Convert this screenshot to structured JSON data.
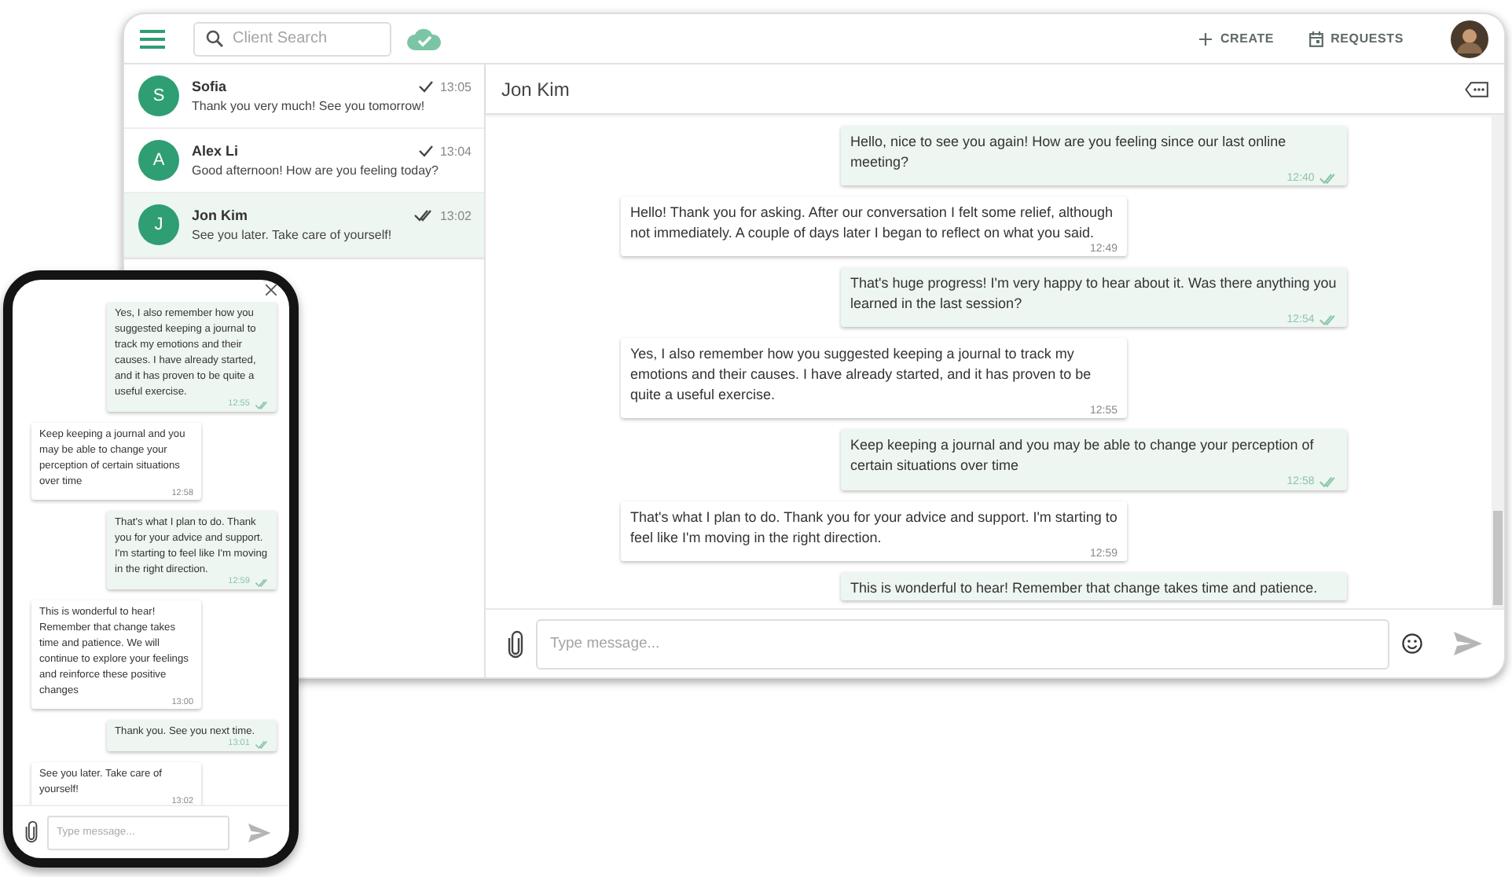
{
  "desktop": {
    "header": {
      "search": {
        "placeholder": "Client Search"
      },
      "actions": [
        {
          "kind": "create",
          "label": "CREATE"
        },
        {
          "kind": "requests",
          "label": "REQUESTS"
        }
      ]
    },
    "conversations": [
      {
        "initial": "S",
        "name": "Sofia",
        "preview": "Thank you very much! See you tomorrow!",
        "time": "13:05",
        "read": false,
        "selected": false
      },
      {
        "initial": "A",
        "name": "Alex Li",
        "preview": "Good afternoon! How are you feeling today?",
        "time": "13:04",
        "read": false,
        "selected": false
      },
      {
        "initial": "J",
        "name": "Jon Kim",
        "preview": "See you later. Take care of yourself!",
        "time": "13:02",
        "read": true,
        "selected": true
      }
    ],
    "chat": {
      "title": "Jon Kim",
      "messages": [
        {
          "outgoing": true,
          "text": "Hello, nice to see you again! How are you feeling since our last online meeting?",
          "time": "12:40",
          "read": true
        },
        {
          "outgoing": false,
          "text": "Hello! Thank you for asking. After our conversation I felt some relief, although not immediately. A couple of days later I began to reflect on what you said.",
          "time": "12:49"
        },
        {
          "outgoing": true,
          "text": "That's huge progress! I'm very happy to hear about it. Was there anything you learned in the last session?",
          "time": "12:54",
          "read": true
        },
        {
          "outgoing": false,
          "text": "Yes, I also remember how you suggested keeping a journal to track my emotions and their causes. I have already started, and it has proven to be quite a useful exercise.",
          "time": "12:55"
        },
        {
          "outgoing": true,
          "text": "Keep keeping a journal and you may be able to change your perception of certain situations over time",
          "time": "12:58",
          "read": true
        },
        {
          "outgoing": false,
          "text": "That's what I plan to do. Thank you for your advice and support. I'm starting to feel like I'm moving in the right direction.",
          "time": "12:59"
        },
        {
          "outgoing": true,
          "text": "This is wonderful to hear! Remember that change takes time and patience."
        }
      ],
      "composer": {
        "placeholder": "Type message..."
      }
    }
  },
  "phone": {
    "messages": [
      {
        "outgoing": true,
        "text": "Yes, I also remember how you suggested keeping a journal to track my emotions and their causes. I have already started, and it has proven to be quite a useful exercise.",
        "time": "12:55",
        "read": true
      },
      {
        "outgoing": false,
        "text": "Keep keeping a journal and you may be able to change your perception of certain situations over time",
        "time": "12:58"
      },
      {
        "outgoing": true,
        "text": "That's what I plan to do. Thank you for your advice and support. I'm starting to feel like I'm moving in the right direction.",
        "time": "12:59",
        "read": true
      },
      {
        "outgoing": false,
        "text": "This is wonderful to hear! Remember that change takes time and patience. We will continue to explore your feelings and reinforce these positive changes",
        "time": "13:00"
      },
      {
        "outgoing": true,
        "text": "Thank you. See you next time.",
        "time": "13:01",
        "read": true
      },
      {
        "outgoing": false,
        "text": "See you later. Take care of yourself!",
        "time": "13:02"
      }
    ],
    "composer": {
      "placeholder": "Type message..."
    }
  }
}
